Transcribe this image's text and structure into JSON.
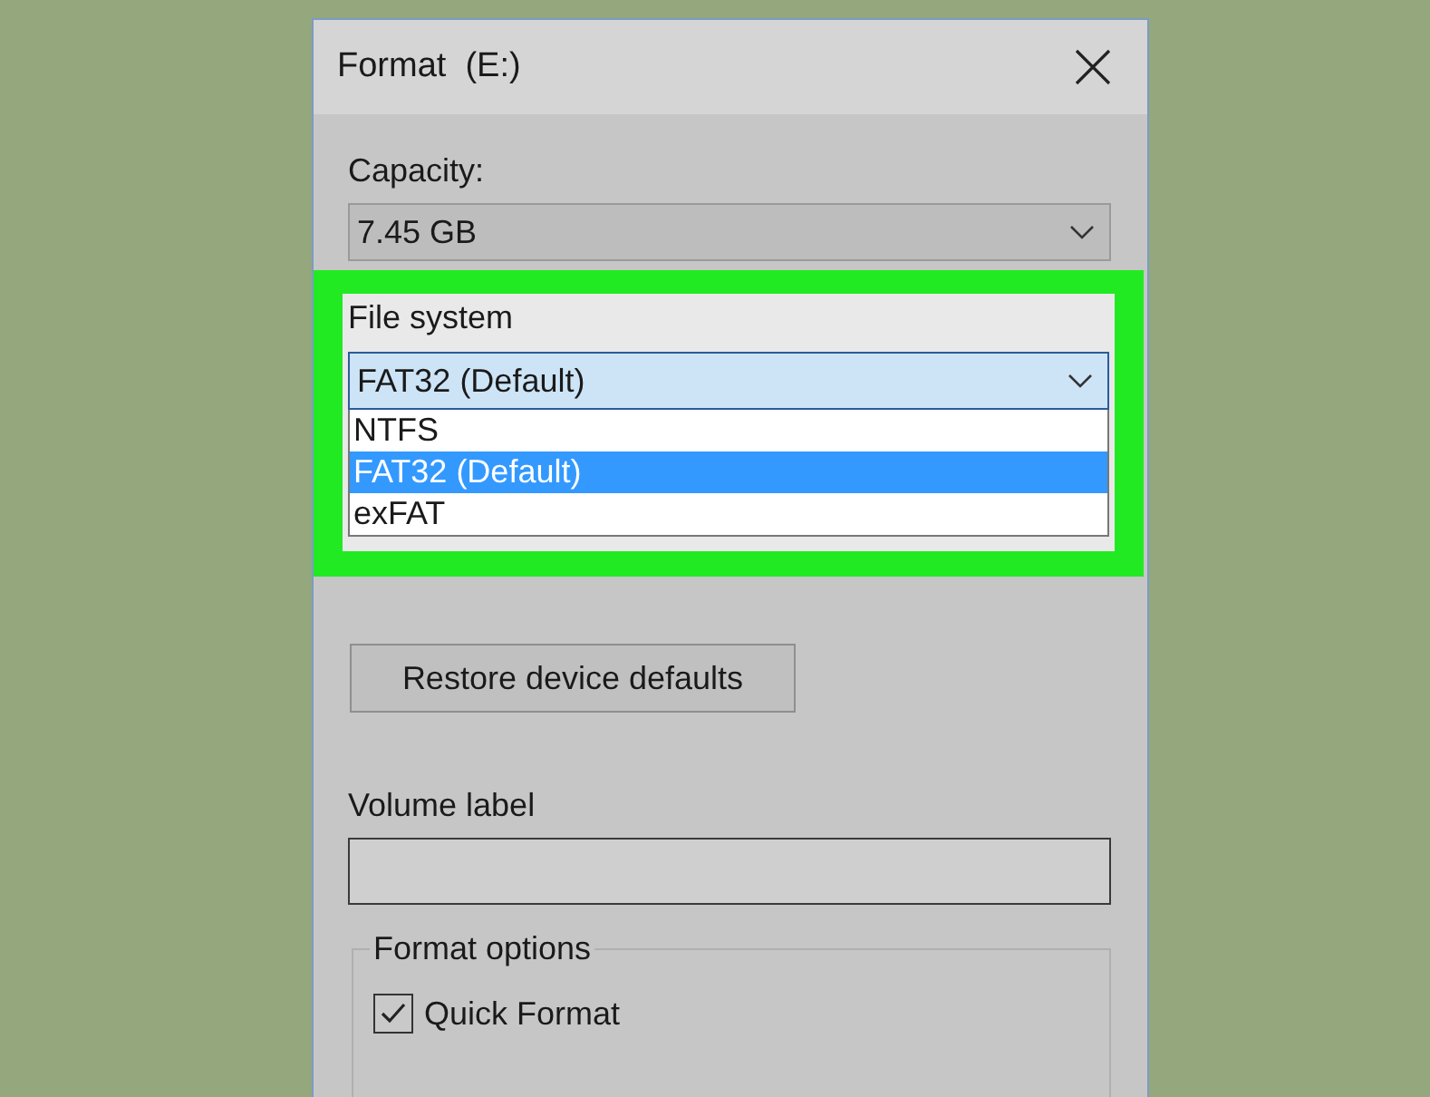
{
  "window": {
    "title": "Format  (E:)"
  },
  "capacity": {
    "label": "Capacity:",
    "value": "7.45 GB"
  },
  "file_system": {
    "label": "File system",
    "value": "FAT32 (Default)",
    "highlighted": true,
    "open": true,
    "options": [
      {
        "label": "NTFS",
        "selected": false
      },
      {
        "label": "FAT32 (Default)",
        "selected": true
      },
      {
        "label": "exFAT",
        "selected": false
      }
    ]
  },
  "restore_button": "Restore device defaults",
  "volume_label": {
    "label": "Volume label"
  },
  "format_options": {
    "title": "Format options",
    "options": [
      {
        "label": "Quick Format",
        "checked": true
      }
    ]
  }
}
